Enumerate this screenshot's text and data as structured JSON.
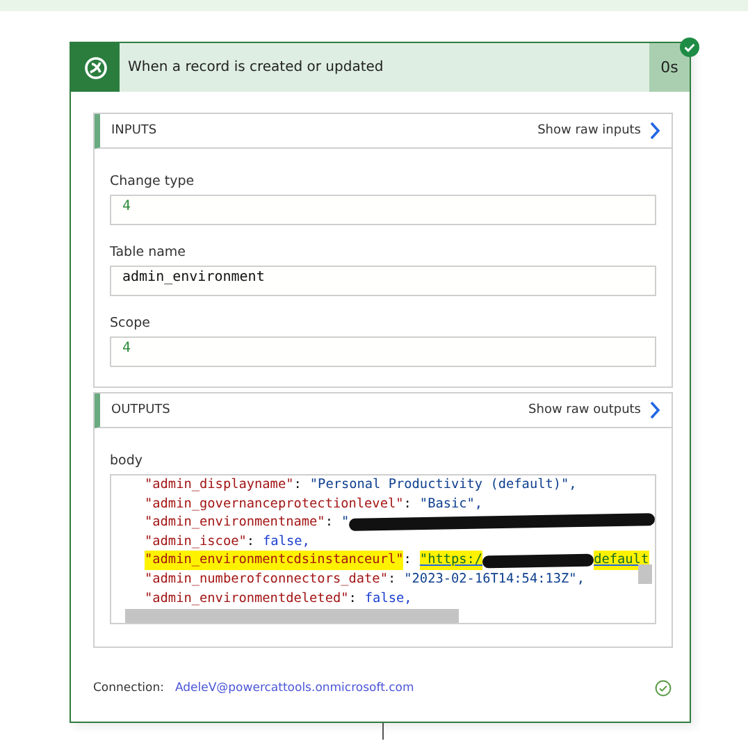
{
  "trigger": {
    "title": "When a record is created or updated",
    "duration": "0s",
    "succeeded": true
  },
  "inputs": {
    "heading": "INPUTS",
    "raw_link": "Show raw inputs",
    "fields": [
      {
        "label": "Change type",
        "value": "4",
        "kind": "number"
      },
      {
        "label": "Table name",
        "value": "admin_environment",
        "kind": "text"
      },
      {
        "label": "Scope",
        "value": "4",
        "kind": "number"
      }
    ]
  },
  "outputs": {
    "heading": "OUTPUTS",
    "raw_link": "Show raw outputs",
    "body_label": "body",
    "separator": ":",
    "lines": [
      {
        "key": "\"admin_displayname\"",
        "value": "\"Personal Productivity (default)\",",
        "kind": "string",
        "highlighted": false,
        "redacted": false
      },
      {
        "key": "\"admin_governanceprotectionlevel\"",
        "value": "\"Basic\",",
        "kind": "string",
        "highlighted": false,
        "redacted": false
      },
      {
        "key": "\"admin_environmentname\"",
        "value": "\"",
        "kind": "string",
        "highlighted": false,
        "redacted": true
      },
      {
        "key": "\"admin_iscoe\"",
        "value": "false,",
        "kind": "boolean",
        "highlighted": false,
        "redacted": false
      },
      {
        "key": "\"admin_environmentcdsinstanceurl\"",
        "value": "\"https:/",
        "suffix": "default",
        "kind": "link",
        "highlighted": true,
        "redacted": true
      },
      {
        "key": "\"admin_numberofconnectors_date\"",
        "value": "\"2023-02-16T14:54:13Z\",",
        "kind": "string",
        "highlighted": false,
        "redacted": false
      },
      {
        "key": "\"admin_environmentdeleted\"",
        "value": "false,",
        "kind": "boolean",
        "highlighted": false,
        "redacted": false
      }
    ]
  },
  "connection": {
    "label": "Connection:",
    "account": "AdeleV@powercattools.onmicrosoft.com",
    "ok": true
  }
}
